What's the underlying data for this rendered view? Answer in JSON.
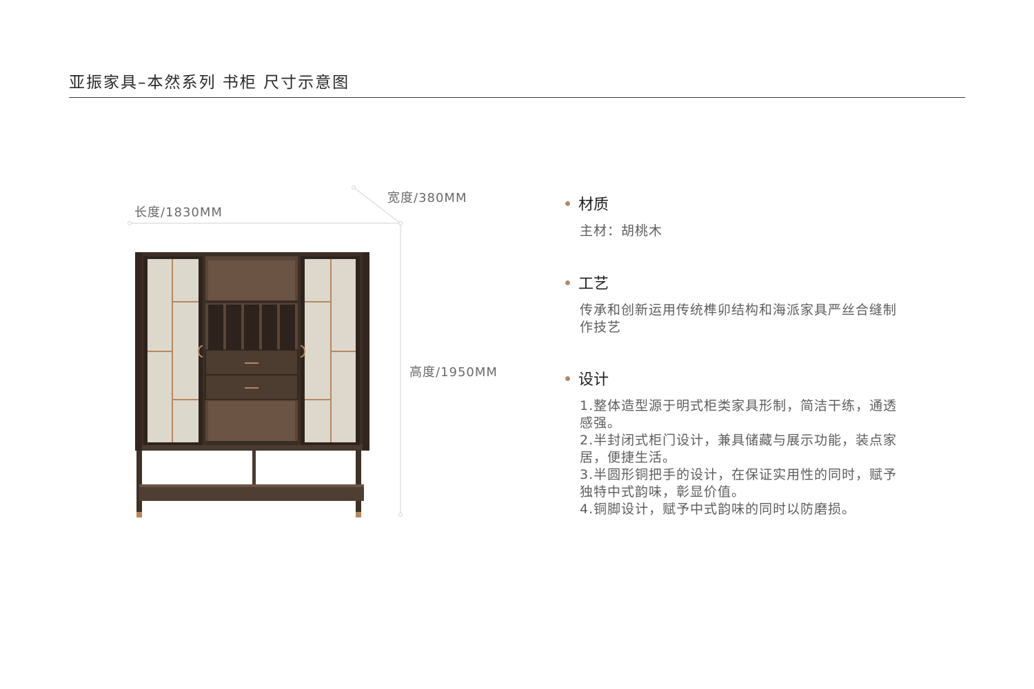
{
  "header": {
    "title": "亚振家具–本然系列 书柜 尺寸示意图"
  },
  "dimensions": {
    "length": "长度/1830MM",
    "width": "宽度/380MM",
    "height": "高度/1950MM"
  },
  "colors": {
    "accent": "#b5886a",
    "wood": "#4a3a2f",
    "panel": "#ddd8cc",
    "brass": "#b7875f"
  },
  "specs": {
    "material": {
      "heading": "材质",
      "lines": [
        "主材：胡桃木"
      ]
    },
    "craft": {
      "heading": "工艺",
      "lines": [
        "传承和创新运用传统榫卯结构和海派家具严丝合缝制",
        "作技艺"
      ]
    },
    "design": {
      "heading": "设计",
      "lines": [
        "1.整体造型源于明式柜类家具形制，简洁干练，通透",
        "感强。",
        "2.半封闭式柜门设计，兼具储藏与展示功能，装点家",
        "居，便捷生活。",
        "3.半圆形铜把手的设计，在保证实用性的同时，赋予",
        "独特中式韵味，彰显价值。",
        "4.铜脚设计，赋予中式韵味的同时以防磨损。"
      ]
    }
  }
}
